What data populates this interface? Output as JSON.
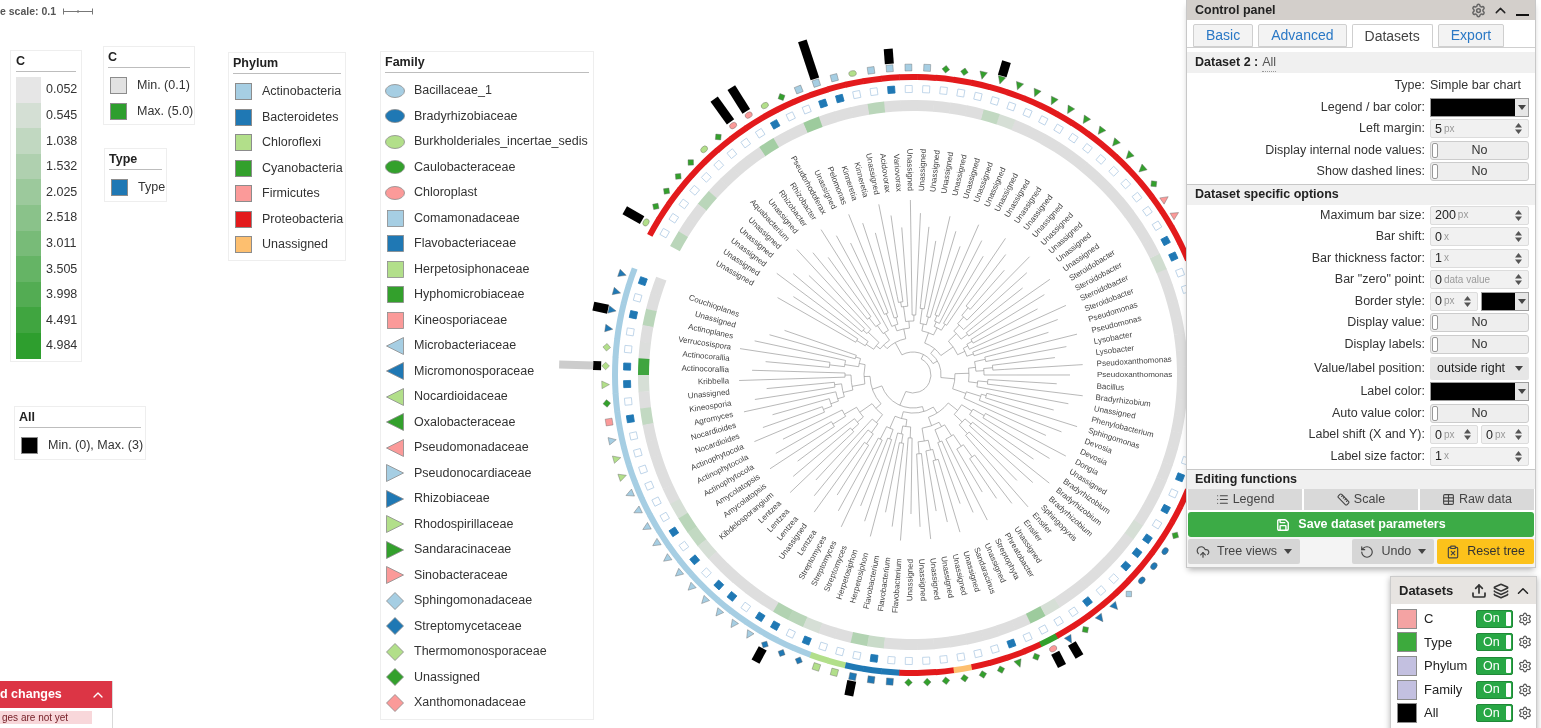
{
  "tree_scale": {
    "label": "e scale: 0.1"
  },
  "legend_c_scale": {
    "title": "C",
    "items": [
      {
        "label": "0.052",
        "color": "#e6e6e6"
      },
      {
        "label": "0.545",
        "color": "#d4dfd4"
      },
      {
        "label": "1.038",
        "color": "#c1d8c1"
      },
      {
        "label": "1.532",
        "color": "#afd0af"
      },
      {
        "label": "2.025",
        "color": "#9cc99c"
      },
      {
        "label": "2.518",
        "color": "#8ac28a"
      },
      {
        "label": "3.011",
        "color": "#78bb78"
      },
      {
        "label": "3.505",
        "color": "#65b465"
      },
      {
        "label": "3.998",
        "color": "#53ac53"
      },
      {
        "label": "4.491",
        "color": "#40a540"
      },
      {
        "label": "4.984",
        "color": "#2e9e2e"
      }
    ]
  },
  "legend_c_range": {
    "title": "C",
    "items": [
      {
        "label": "Min. (0.1)",
        "color": "#e2e2e2"
      },
      {
        "label": "Max. (5.0)",
        "color": "#2e9e2e"
      }
    ]
  },
  "legend_type": {
    "title": "Type",
    "items": [
      {
        "label": "Type",
        "color": "#1f78b4"
      }
    ]
  },
  "legend_phylum": {
    "title": "Phylum",
    "items": [
      {
        "label": "Actinobacteria",
        "color": "#a6cee3"
      },
      {
        "label": "Bacteroidetes",
        "color": "#1f78b4"
      },
      {
        "label": "Chloroflexi",
        "color": "#b2df8a"
      },
      {
        "label": "Cyanobacteria",
        "color": "#33a02c"
      },
      {
        "label": "Firmicutes",
        "color": "#fb9a99"
      },
      {
        "label": "Proteobacteria",
        "color": "#e31a1c"
      },
      {
        "label": "Unassigned",
        "color": "#fdbf6f"
      }
    ]
  },
  "legend_family": {
    "title": "Family",
    "items": [
      {
        "label": "Bacillaceae_1",
        "kind": "circle",
        "color": "#a6cee3"
      },
      {
        "label": "Bradyrhizobiaceae",
        "kind": "circle",
        "color": "#1f78b4"
      },
      {
        "label": "Burkholderiales_incertae_sedis",
        "kind": "circle",
        "color": "#b2df8a"
      },
      {
        "label": "Caulobacteraceae",
        "kind": "circle",
        "color": "#33a02c"
      },
      {
        "label": "Chloroplast",
        "kind": "circle",
        "color": "#fb9a99"
      },
      {
        "label": "Comamonadaceae",
        "kind": "square",
        "color": "#a6cee3"
      },
      {
        "label": "Flavobacteriaceae",
        "kind": "square",
        "color": "#1f78b4"
      },
      {
        "label": "Herpetosiphonaceae",
        "kind": "square",
        "color": "#b2df8a"
      },
      {
        "label": "Hyphomicrobiaceae",
        "kind": "square",
        "color": "#33a02c"
      },
      {
        "label": "Kineosporiaceae",
        "kind": "square",
        "color": "#fb9a99"
      },
      {
        "label": "Microbacteriaceae",
        "kind": "triangle-left",
        "color": "#a6cee3"
      },
      {
        "label": "Micromonosporaceae",
        "kind": "triangle-left",
        "color": "#1f78b4"
      },
      {
        "label": "Nocardioidaceae",
        "kind": "triangle-left",
        "color": "#b2df8a"
      },
      {
        "label": "Oxalobacteraceae",
        "kind": "triangle-left",
        "color": "#33a02c"
      },
      {
        "label": "Pseudomonadaceae",
        "kind": "triangle-left",
        "color": "#fb9a99"
      },
      {
        "label": "Pseudonocardiaceae",
        "kind": "triangle-right",
        "color": "#a6cee3"
      },
      {
        "label": "Rhizobiaceae",
        "kind": "triangle-right",
        "color": "#1f78b4"
      },
      {
        "label": "Rhodospirillaceae",
        "kind": "triangle-right",
        "color": "#b2df8a"
      },
      {
        "label": "Sandaracinaceae",
        "kind": "triangle-right",
        "color": "#33a02c"
      },
      {
        "label": "Sinobacteraceae",
        "kind": "triangle-right",
        "color": "#fb9a99"
      },
      {
        "label": "Sphingomonadaceae",
        "kind": "diamond",
        "color": "#a6cee3"
      },
      {
        "label": "Streptomycetaceae",
        "kind": "diamond",
        "color": "#1f78b4"
      },
      {
        "label": "Thermomonosporaceae",
        "kind": "diamond",
        "color": "#b2df8a"
      },
      {
        "label": "Unassigned",
        "kind": "diamond",
        "color": "#33a02c"
      },
      {
        "label": "Xanthomonadaceae",
        "kind": "diamond",
        "color": "#fb9a99"
      }
    ]
  },
  "legend_all": {
    "title": "All",
    "items": [
      {
        "label": "Min. (0), Max. (3)",
        "color": "#000000"
      }
    ]
  },
  "tree": {
    "leaves": [
      {
        "label": "Couchioplanes",
        "heat": {
          "color": "#dedede"
        },
        "type": {
          "filled": true
        },
        "phylum": {
          "color": "#a6cee3"
        },
        "family": {
          "kind": "triangle-left",
          "color": "#1f78b4"
        }
      },
      {
        "label": "Unassigned",
        "heat": {
          "color": "#dedede"
        },
        "type": {
          "filled": false
        },
        "phylum": {
          "color": "#a6cee3"
        },
        "family": {
          "kind": "triangle-left",
          "color": "#1f78b4"
        }
      },
      {
        "label": "Actinoplanes",
        "heat": {
          "color": "#bad6ba"
        },
        "type": {
          "filled": true
        },
        "phylum": {
          "color": "#a6cee3"
        },
        "family": {
          "kind": "triangle-left",
          "color": "#1f78b4"
        },
        "bar": {
          "kind": "short"
        }
      },
      {
        "label": "Verrucosispora",
        "heat": {
          "color": "#dedede"
        },
        "type": {
          "filled": false
        },
        "phylum": {
          "color": "#a6cee3"
        },
        "family": {
          "kind": "triangle-left",
          "color": "#1f78b4"
        }
      },
      {
        "label": "Actinocorallia",
        "heat": {
          "color": "#dcdedc"
        },
        "type": {
          "filled": false
        },
        "phylum": {
          "color": "#a6cee3"
        },
        "family": {
          "kind": "diamond",
          "color": "#b2df8a"
        }
      },
      {
        "label": "Actinocorallia",
        "heat": {
          "color": "#3fa53f"
        },
        "type": {
          "filled": true
        },
        "phylum": {
          "color": "#a6cee3"
        },
        "family": {
          "kind": "diamond",
          "color": "#b2df8a"
        },
        "bar": {
          "kind": "tiny",
          "overflow": true
        }
      },
      {
        "label": "Kribbella",
        "heat": {
          "color": "#d6dfd6"
        },
        "type": {
          "filled": true
        },
        "phylum": {
          "color": "#a6cee3"
        },
        "family": {
          "kind": "triangle-left",
          "color": "#b2df8a"
        }
      },
      {
        "label": "Unassigned",
        "heat": {
          "color": "#dedede"
        },
        "type": {
          "filled": false
        },
        "phylum": {
          "color": "#a6cee3"
        },
        "family": {
          "kind": "diamond",
          "color": "#33a02c"
        }
      },
      {
        "label": "Kineosporia",
        "heat": {
          "color": "#c2d9c2"
        },
        "type": {
          "filled": true
        },
        "phylum": {
          "color": "#a6cee3"
        },
        "family": {
          "kind": "square",
          "color": "#fb9a99"
        }
      },
      {
        "label": "Agromyces",
        "heat": {
          "color": "#dedede"
        },
        "type": {
          "filled": false
        },
        "phylum": {
          "color": "#a6cee3"
        },
        "family": {
          "kind": "triangle-left",
          "color": "#a6cee3"
        }
      },
      {
        "label": "Nocardioides",
        "heat": {
          "color": "#dedede"
        },
        "type": {
          "filled": false
        },
        "phylum": {
          "color": "#a6cee3"
        },
        "family": {
          "kind": "triangle-left",
          "color": "#b2df8a"
        }
      },
      {
        "label": "Nocardioides",
        "heat": {
          "color": "#dedede"
        },
        "type": {
          "filled": false
        },
        "phylum": {
          "color": "#a6cee3"
        },
        "family": {
          "kind": "triangle-left",
          "color": "#b2df8a"
        }
      },
      {
        "label": "Actinophytocola",
        "heat": {
          "color": "#dedede"
        },
        "type": {
          "filled": false
        },
        "phylum": {
          "color": "#a6cee3"
        },
        "family": {
          "kind": "triangle-right",
          "color": "#a6cee3"
        }
      },
      {
        "label": "Actinophytocola",
        "heat": {
          "color": "#dedede"
        },
        "type": {
          "filled": false
        },
        "phylum": {
          "color": "#a6cee3"
        },
        "family": {
          "kind": "triangle-right",
          "color": "#a6cee3"
        }
      },
      {
        "label": "Actinophytocola",
        "heat": {
          "color": "#d6dfd6"
        },
        "type": {
          "filled": false
        },
        "phylum": {
          "color": "#a6cee3"
        },
        "family": {
          "kind": "triangle-right",
          "color": "#a6cee3"
        }
      },
      {
        "label": "Amycolatopsis",
        "heat": {
          "color": "#bad6ba"
        },
        "type": {
          "filled": true
        },
        "phylum": {
          "color": "#a6cee3"
        },
        "family": {
          "kind": "triangle-right",
          "color": "#a6cee3"
        }
      },
      {
        "label": "Amycolatopsis",
        "heat": {
          "color": "#c2d9c2"
        },
        "type": {
          "filled": false
        },
        "phylum": {
          "color": "#a6cee3"
        },
        "family": {
          "kind": "triangle-right",
          "color": "#a6cee3"
        }
      },
      {
        "label": "Kibdelosporangium",
        "heat": {
          "color": "#d6dfd6"
        },
        "type": {
          "filled": true
        },
        "phylum": {
          "color": "#a6cee3"
        },
        "family": {
          "kind": "triangle-right",
          "color": "#a6cee3"
        }
      },
      {
        "label": "Lentzea",
        "heat": {
          "color": "#dedede"
        },
        "type": {
          "filled": false
        },
        "phylum": {
          "color": "#a6cee3"
        },
        "family": {
          "kind": "triangle-right",
          "color": "#a6cee3"
        }
      },
      {
        "label": "Lentzea",
        "heat": {
          "color": "#dedede"
        },
        "type": {
          "filled": true
        },
        "phylum": {
          "color": "#a6cee3"
        },
        "family": {
          "kind": "triangle-right",
          "color": "#a6cee3"
        }
      },
      {
        "label": "Lentzea",
        "heat": {
          "color": "#dedede"
        },
        "type": {
          "filled": true
        },
        "phylum": {
          "color": "#a6cee3"
        },
        "family": {
          "kind": "triangle-right",
          "color": "#a6cee3"
        }
      },
      {
        "label": "Unassigned",
        "heat": {
          "color": "#dedede"
        },
        "type": {
          "filled": false
        },
        "phylum": {
          "color": "#a6cee3"
        },
        "family": {
          "kind": "triangle-right",
          "color": "#a6cee3"
        }
      },
      {
        "label": "Lentzea",
        "heat": {
          "color": "#dedede"
        },
        "type": {
          "filled": true
        },
        "phylum": {
          "color": "#a6cee3"
        },
        "family": {
          "kind": "triangle-right",
          "color": "#a6cee3"
        }
      },
      {
        "label": "Streptomyces",
        "heat": {
          "color": "#b2d3b2"
        },
        "type": {
          "filled": true
        },
        "phylum": {
          "color": "#a6cee3"
        },
        "family": {
          "kind": "diamond",
          "color": "#1f78b4"
        },
        "bar": {
          "kind": "short"
        }
      },
      {
        "label": "Streptomyces",
        "heat": {
          "color": "#bad6ba"
        },
        "type": {
          "filled": false
        },
        "phylum": {
          "color": "#a6cee3"
        },
        "family": {
          "kind": "diamond",
          "color": "#1f78b4"
        }
      },
      {
        "label": "Streptomyces",
        "heat": {
          "color": "#d6dfd6"
        },
        "type": {
          "filled": true
        },
        "phylum": {
          "color": "#a6cee3"
        },
        "family": {
          "kind": "diamond",
          "color": "#1f78b4"
        }
      },
      {
        "label": "Herpetosiphon",
        "heat": {
          "color": "#dedede"
        },
        "type": {
          "filled": false
        },
        "phylum": {
          "color": "#b2df8a"
        },
        "family": {
          "kind": "square",
          "color": "#b2df8a"
        }
      },
      {
        "label": "Herpetosiphon",
        "heat": {
          "color": "#dedede"
        },
        "type": {
          "filled": false
        },
        "phylum": {
          "color": "#b2df8a"
        },
        "family": {
          "kind": "square",
          "color": "#b2df8a"
        }
      },
      {
        "label": "Flavobacterium",
        "heat": {
          "color": "#b2d3b2"
        },
        "type": {
          "filled": false
        },
        "phylum": {
          "color": "#1f78b4"
        },
        "family": {
          "kind": "square",
          "color": "#1f78b4"
        },
        "bar": {
          "kind": "short"
        }
      },
      {
        "label": "Flavobacterium",
        "heat": {
          "color": "#c9dbc9"
        },
        "type": {
          "filled": true
        },
        "phylum": {
          "color": "#1f78b4"
        },
        "family": {
          "kind": "square",
          "color": "#1f78b4"
        }
      },
      {
        "label": "Flavobacterium",
        "heat": {
          "color": "#dedede"
        },
        "type": {
          "filled": false
        },
        "phylum": {
          "color": "#1f78b4"
        },
        "family": {
          "kind": "square",
          "color": "#1f78b4"
        }
      },
      {
        "label": "Unassigned",
        "heat": {
          "color": "#dedede"
        },
        "type": {
          "filled": false
        },
        "phylum": {
          "color": "#e31a1c"
        },
        "family": {
          "kind": "diamond",
          "color": "#33a02c"
        }
      },
      {
        "label": "Unassigned",
        "heat": {
          "color": "#dedede"
        },
        "type": {
          "filled": false
        },
        "phylum": {
          "color": "#e31a1c"
        },
        "family": {
          "kind": "diamond",
          "color": "#33a02c"
        }
      },
      {
        "label": "Unassigned",
        "heat": {
          "color": "#dedede"
        },
        "type": {
          "filled": false
        },
        "phylum": {
          "color": "#e31a1c"
        },
        "family": {
          "kind": "diamond",
          "color": "#33a02c"
        }
      },
      {
        "label": "Unassigned",
        "heat": {
          "color": "#dedede"
        },
        "type": {
          "filled": false
        },
        "phylum": {
          "color": "#fdbf6f"
        },
        "family": {
          "kind": "diamond",
          "color": "#33a02c"
        }
      },
      {
        "label": "Unassigned",
        "heat": {
          "color": "#dedede"
        },
        "type": {
          "filled": false
        },
        "phylum": {
          "color": "#e31a1c"
        },
        "family": {
          "kind": "diamond",
          "color": "#33a02c"
        }
      },
      {
        "label": "Unassigned",
        "heat": {
          "color": "#dedede"
        },
        "type": {
          "filled": false
        },
        "phylum": {
          "color": "#e31a1c"
        },
        "family": {
          "kind": "diamond",
          "color": "#33a02c"
        }
      },
      {
        "label": "Sandaracinus",
        "heat": {
          "color": "#dedede"
        },
        "type": {
          "filled": true
        },
        "phylum": {
          "color": "#e31a1c"
        },
        "family": {
          "kind": "triangle-right",
          "color": "#33a02c"
        }
      },
      {
        "label": "Unassigned",
        "heat": {
          "color": "#dedede"
        },
        "type": {
          "filled": false
        },
        "phylum": {
          "color": "#e31a1c"
        },
        "family": {
          "kind": "diamond",
          "color": "#33a02c"
        }
      },
      {
        "label": "Streptophyta",
        "heat": {
          "color": "#9dcb9d"
        },
        "type": {
          "filled": false
        },
        "phylum": {
          "color": "#33a02c"
        },
        "family": {
          "kind": "circle",
          "color": "#fb9a99"
        },
        "bar": {
          "kind": "short"
        }
      },
      {
        "label": "Phreatobacter",
        "heat": {
          "color": "#d6dfd6"
        },
        "type": {
          "filled": false
        },
        "phylum": {
          "color": "#e31a1c"
        },
        "family": {
          "kind": "triangle-right",
          "color": "#1f78b4"
        },
        "bar": {
          "kind": "short"
        }
      },
      {
        "label": "Unassigned",
        "heat": {
          "color": "#dedede"
        },
        "type": {
          "filled": false
        },
        "phylum": {
          "color": "#e31a1c"
        },
        "family": {
          "kind": "diamond",
          "color": "#33a02c"
        }
      },
      {
        "label": "Ensifer",
        "heat": {
          "color": "#dedede"
        },
        "type": {
          "filled": true
        },
        "phylum": {
          "color": "#e31a1c"
        },
        "family": {
          "kind": "triangle-right",
          "color": "#1f78b4"
        }
      },
      {
        "label": "Ensifer",
        "heat": {
          "color": "#dedede"
        },
        "type": {
          "filled": false
        },
        "phylum": {
          "color": "#e31a1c"
        },
        "family": {
          "kind": "triangle-right",
          "color": "#1f78b4"
        }
      },
      {
        "label": "Sphingopyxis",
        "heat": {
          "color": "#dedede"
        },
        "type": {
          "filled": false
        },
        "phylum": {
          "color": "#e31a1c"
        },
        "family": {
          "kind": "diamond",
          "color": "#a6cee3"
        }
      },
      {
        "label": "Bradyrhizobium",
        "heat": {
          "color": "#dedede"
        },
        "type": {
          "filled": true
        },
        "phylum": {
          "color": "#e31a1c"
        },
        "family": {
          "kind": "circle",
          "color": "#1f78b4"
        }
      },
      {
        "label": "Bradyrhizobium",
        "heat": {
          "color": "#dedede"
        },
        "type": {
          "filled": true
        },
        "phylum": {
          "color": "#e31a1c"
        },
        "family": {
          "kind": "circle",
          "color": "#1f78b4"
        }
      },
      {
        "label": "Bradyrhizobium",
        "heat": {
          "color": "#d6dfd6"
        },
        "type": {
          "filled": true
        },
        "phylum": {
          "color": "#e31a1c"
        },
        "family": {
          "kind": "circle",
          "color": "#1f78b4"
        }
      },
      {
        "label": "Unassigned",
        "heat": {
          "color": "#dedede"
        },
        "type": {
          "filled": false
        },
        "phylum": {
          "color": "#e31a1c"
        },
        "family": {
          "kind": "diamond",
          "color": "#33a02c"
        }
      },
      {
        "label": "Dongia",
        "heat": {
          "color": "#dedede"
        },
        "type": {
          "filled": true
        },
        "phylum": {
          "color": "#e31a1c"
        }
      },
      {
        "label": "Devosia",
        "heat": {
          "color": "#dedede"
        },
        "type": {
          "filled": false
        },
        "phylum": {
          "color": "#e31a1c"
        }
      },
      {
        "label": "Devosia",
        "heat": {
          "color": "#dedede"
        },
        "type": {
          "filled": true
        }
      },
      {
        "label": "Sphingomonas",
        "heat": {
          "color": "#dedede"
        },
        "type": {
          "filled": false
        }
      },
      {
        "label": "Phenylobacterium",
        "heat": {
          "color": "#dedede"
        }
      },
      {
        "label": "Unassigned",
        "heat": {
          "color": "#dedede"
        }
      },
      {
        "label": "Bradyrhizobium",
        "heat": {
          "color": "#dedede"
        }
      },
      {
        "label": "Bacillus",
        "heat": {
          "color": "#dedede"
        }
      },
      {
        "label": "Pseudoxanthomonas",
        "heat": {
          "color": "#dedede"
        }
      },
      {
        "label": "Pseudoxanthomonas",
        "heat": {
          "color": "#dedede"
        }
      },
      {
        "label": "Lysobacter",
        "heat": {
          "color": "#dedede"
        }
      },
      {
        "label": "Lysobacter",
        "heat": {
          "color": "#dedede"
        }
      },
      {
        "label": "Pseudomonas",
        "heat": {
          "color": "#dedede"
        }
      },
      {
        "label": "Pseudomonas",
        "heat": {
          "color": "#dedede"
        },
        "type": {
          "filled": false
        }
      },
      {
        "label": "Steroidobacter",
        "heat": {
          "color": "#dedede"
        },
        "type": {
          "filled": false
        }
      },
      {
        "label": "Steroidobacter",
        "heat": {
          "color": "#d0ddd0"
        },
        "type": {
          "filled": true
        },
        "phylum": {
          "color": "#e31a1c"
        }
      },
      {
        "label": "Steroidobacter",
        "heat": {
          "color": "#dedede"
        },
        "type": {
          "filled": true
        },
        "phylum": {
          "color": "#e31a1c"
        }
      },
      {
        "label": "Steroidobacter",
        "heat": {
          "color": "#dedede"
        },
        "type": {
          "filled": false
        },
        "phylum": {
          "color": "#e31a1c"
        },
        "family": {
          "kind": "triangle-right",
          "color": "#fb9a99"
        }
      },
      {
        "label": "Unassigned",
        "heat": {
          "color": "#dedede"
        },
        "type": {
          "filled": false
        },
        "phylum": {
          "color": "#e31a1c"
        },
        "family": {
          "kind": "triangle-right",
          "color": "#fb9a99"
        }
      },
      {
        "label": "Unassigned",
        "heat": {
          "color": "#dedede"
        },
        "type": {
          "filled": false
        },
        "phylum": {
          "color": "#e31a1c"
        },
        "family": {
          "kind": "diamond",
          "color": "#33a02c"
        }
      },
      {
        "label": "Unassigned",
        "heat": {
          "color": "#dedede"
        },
        "type": {
          "filled": false
        },
        "phylum": {
          "color": "#e31a1c"
        },
        "family": {
          "kind": "triangle-left",
          "color": "#33a02c"
        }
      },
      {
        "label": "Unassigned",
        "heat": {
          "color": "#dedede"
        },
        "type": {
          "filled": false
        },
        "phylum": {
          "color": "#e31a1c"
        },
        "family": {
          "kind": "triangle-left",
          "color": "#33a02c"
        }
      },
      {
        "label": "Unassigned",
        "heat": {
          "color": "#dedede"
        },
        "type": {
          "filled": false
        },
        "phylum": {
          "color": "#e31a1c"
        },
        "family": {
          "kind": "triangle-left",
          "color": "#33a02c"
        }
      },
      {
        "label": "Unassigned",
        "heat": {
          "color": "#dedede"
        },
        "type": {
          "filled": false
        },
        "phylum": {
          "color": "#e31a1c"
        },
        "family": {
          "kind": "triangle-left",
          "color": "#33a02c"
        }
      },
      {
        "label": "Unassigned",
        "heat": {
          "color": "#dedede"
        },
        "type": {
          "filled": false
        },
        "phylum": {
          "color": "#e31a1c"
        },
        "family": {
          "kind": "triangle-left",
          "color": "#33a02c"
        }
      },
      {
        "label": "Unassigned",
        "heat": {
          "color": "#dedede"
        },
        "type": {
          "filled": false
        },
        "phylum": {
          "color": "#e31a1c"
        },
        "family": {
          "kind": "triangle-left",
          "color": "#33a02c"
        }
      },
      {
        "label": "Unassigned",
        "heat": {
          "color": "#dedede"
        },
        "type": {
          "filled": false
        },
        "phylum": {
          "color": "#e31a1c"
        },
        "family": {
          "kind": "triangle-left",
          "color": "#33a02c"
        }
      },
      {
        "label": "Unassigned",
        "heat": {
          "color": "#dedede"
        },
        "type": {
          "filled": false
        },
        "phylum": {
          "color": "#e31a1c"
        },
        "family": {
          "kind": "triangle-left",
          "color": "#33a02c"
        }
      },
      {
        "label": "Unassigned",
        "heat": {
          "color": "#d6dfd6"
        },
        "type": {
          "filled": false
        },
        "phylum": {
          "color": "#e31a1c"
        },
        "family": {
          "kind": "triangle-left",
          "color": "#33a02c"
        }
      },
      {
        "label": "Unassigned",
        "heat": {
          "color": "#c2d9c2"
        },
        "type": {
          "filled": false
        },
        "phylum": {
          "color": "#e31a1c"
        },
        "family": {
          "kind": "triangle-left",
          "color": "#33a02c"
        },
        "bar": {
          "kind": "short"
        }
      },
      {
        "label": "Unassigned",
        "heat": {
          "color": "#dedede"
        },
        "type": {
          "filled": false
        },
        "phylum": {
          "color": "#e31a1c"
        },
        "family": {
          "kind": "triangle-left",
          "color": "#33a02c"
        }
      },
      {
        "label": "Unassigned",
        "heat": {
          "color": "#dedede"
        },
        "type": {
          "filled": false
        },
        "phylum": {
          "color": "#e31a1c"
        },
        "family": {
          "kind": "diamond",
          "color": "#33a02c"
        }
      },
      {
        "label": "Unassigned",
        "heat": {
          "color": "#dedede"
        },
        "type": {
          "filled": false
        },
        "phylum": {
          "color": "#e31a1c"
        },
        "family": {
          "kind": "diamond",
          "color": "#33a02c"
        }
      },
      {
        "label": "Unassigned",
        "heat": {
          "color": "#dedede"
        },
        "type": {
          "filled": false
        },
        "phylum": {
          "color": "#e31a1c"
        },
        "family": {
          "kind": "square",
          "color": "#a6cee3"
        }
      },
      {
        "label": "Unassigned",
        "heat": {
          "color": "#dedede"
        },
        "type": {
          "filled": false
        },
        "phylum": {
          "color": "#e31a1c"
        },
        "family": {
          "kind": "square",
          "color": "#a6cee3"
        }
      },
      {
        "label": "Variovorax",
        "heat": {
          "color": "#dedede"
        },
        "type": {
          "filled": true
        },
        "phylum": {
          "color": "#e31a1c"
        },
        "family": {
          "kind": "square",
          "color": "#a6cee3"
        },
        "bar": {
          "kind": "short"
        }
      },
      {
        "label": "Acidovorax",
        "heat": {
          "color": "#bad6ba"
        },
        "type": {
          "filled": false
        },
        "phylum": {
          "color": "#e31a1c"
        },
        "family": {
          "kind": "square",
          "color": "#a6cee3"
        }
      },
      {
        "label": "Unassigned",
        "heat": {
          "color": "#dedede"
        },
        "type": {
          "filled": false
        },
        "phylum": {
          "color": "#e31a1c"
        },
        "family": {
          "kind": "circle",
          "color": "#b2df8a"
        }
      },
      {
        "label": "Kinneretia",
        "heat": {
          "color": "#dedede"
        },
        "type": {
          "filled": true
        },
        "phylum": {
          "color": "#e31a1c"
        },
        "family": {
          "kind": "square",
          "color": "#a6cee3"
        }
      },
      {
        "label": "Kinneretia",
        "heat": {
          "color": "#dedede"
        },
        "type": {
          "filled": true
        },
        "phylum": {
          "color": "#e31a1c"
        },
        "family": {
          "kind": "square",
          "color": "#a6cee3"
        },
        "bar": {
          "kind": "longest"
        }
      },
      {
        "label": "Pelomonas",
        "heat": {
          "color": "#9dcb9d"
        },
        "type": {
          "filled": false
        },
        "phylum": {
          "color": "#e31a1c"
        },
        "family": {
          "kind": "square",
          "color": "#a6cee3"
        }
      },
      {
        "label": "Unassigned",
        "heat": {
          "color": "#dedede"
        },
        "type": {
          "filled": false
        },
        "phylum": {
          "color": "#e31a1c"
        },
        "family": {
          "kind": "diamond",
          "color": "#33a02c"
        }
      },
      {
        "label": "Pseudorhodoferax",
        "heat": {
          "color": "#dedede"
        },
        "type": {
          "filled": true
        },
        "phylum": {
          "color": "#e31a1c"
        },
        "family": {
          "kind": "circle",
          "color": "#b2df8a"
        }
      },
      {
        "label": "Rhizobacter",
        "heat": {
          "color": "#a4cea4"
        },
        "type": {
          "filled": false
        },
        "phylum": {
          "color": "#e31a1c"
        },
        "family": {
          "kind": "circle",
          "color": "#fb9a99"
        },
        "bar": {
          "kind": "long"
        }
      },
      {
        "label": "Rhizobacter",
        "heat": {
          "color": "#dedede"
        },
        "type": {
          "filled": false
        },
        "phylum": {
          "color": "#e31a1c"
        },
        "family": {
          "kind": "circle",
          "color": "#fb9a99"
        },
        "bar": {
          "kind": "long"
        }
      },
      {
        "label": "Unassigned",
        "heat": {
          "color": "#dedede"
        },
        "type": {
          "filled": false
        },
        "phylum": {
          "color": "#e31a1c"
        },
        "family": {
          "kind": "diamond",
          "color": "#33a02c"
        }
      },
      {
        "label": "Aquabacterium",
        "heat": {
          "color": "#dedede"
        },
        "type": {
          "filled": false
        },
        "phylum": {
          "color": "#e31a1c"
        },
        "family": {
          "kind": "circle",
          "color": "#b2df8a"
        }
      },
      {
        "label": "Unassigned",
        "heat": {
          "color": "#dedede"
        },
        "type": {
          "filled": false
        },
        "phylum": {
          "color": "#e31a1c"
        },
        "family": {
          "kind": "diamond",
          "color": "#33a02c"
        }
      },
      {
        "label": "Unassigned",
        "heat": {
          "color": "#bad6ba"
        },
        "type": {
          "filled": false
        },
        "phylum": {
          "color": "#e31a1c"
        },
        "family": {
          "kind": "diamond",
          "color": "#33a02c"
        }
      },
      {
        "label": "Unassigned",
        "heat": {
          "color": "#dedede"
        },
        "type": {
          "filled": false
        },
        "phylum": {
          "color": "#e31a1c"
        },
        "family": {
          "kind": "diamond",
          "color": "#33a02c"
        }
      },
      {
        "label": "Unassigned",
        "heat": {
          "color": "#dedede"
        },
        "type": {
          "filled": false
        },
        "phylum": {
          "color": "#e31a1c"
        },
        "family": {
          "kind": "diamond",
          "color": "#33a02c"
        }
      },
      {
        "label": "Unassigned",
        "heat": {
          "color": "#bad6ba"
        },
        "type": {
          "filled": false
        },
        "phylum": {
          "color": "#e31a1c"
        },
        "family": {
          "kind": "circle",
          "color": "#b2df8a"
        },
        "bar": {
          "kind": "medium"
        }
      }
    ]
  },
  "control_panel": {
    "title": "Control panel",
    "tabs": [
      {
        "label": "Basic",
        "selected": false
      },
      {
        "label": "Advanced",
        "selected": false
      },
      {
        "label": "Datasets",
        "selected": true
      },
      {
        "label": "Export",
        "selected": false
      }
    ],
    "dataset_header": {
      "title": "Dataset 2 :",
      "value": "All"
    },
    "general_rows": [
      {
        "kind": "text",
        "label": "Type:",
        "value": "Simple bar chart"
      },
      {
        "kind": "color",
        "label": "Legend / bar color:",
        "color": "#000000"
      },
      {
        "kind": "number",
        "label": "Left margin:",
        "value": "5",
        "unit": "px"
      },
      {
        "kind": "toggle",
        "label": "Display internal node values:",
        "on": false,
        "value": "No"
      },
      {
        "kind": "toggle",
        "label": "Show dashed lines:",
        "on": false,
        "value": "No"
      }
    ],
    "options_title": "Dataset specific options",
    "option_rows": [
      {
        "kind": "number",
        "label": "Maximum bar size:",
        "value": "200",
        "unit": "px"
      },
      {
        "kind": "number",
        "label": "Bar shift:",
        "value": "0",
        "unit": "x"
      },
      {
        "kind": "number",
        "label": "Bar thickness factor:",
        "value": "1",
        "unit": "x"
      },
      {
        "kind": "number",
        "label": "Bar \"zero\" point:",
        "value": "0",
        "unit": "data value"
      },
      {
        "kind": "number_color",
        "label": "Border style:",
        "value": "0",
        "unit": "px",
        "color": "#000000"
      },
      {
        "kind": "toggle",
        "label": "Display value:",
        "on": false,
        "value": "No"
      },
      {
        "kind": "toggle",
        "label": "Display labels:",
        "on": false,
        "value": "No"
      },
      {
        "kind": "select",
        "label": "Value/label position:",
        "value": "outside right"
      },
      {
        "kind": "color",
        "label": "Label color:",
        "color": "#000000"
      },
      {
        "kind": "toggle",
        "label": "Auto value color:",
        "on": false,
        "value": "No"
      },
      {
        "kind": "number_pair",
        "label": "Label shift (X and Y):",
        "fields": [
          {
            "value": "0",
            "unit": "px"
          },
          {
            "value": "0",
            "unit": "px"
          }
        ]
      },
      {
        "kind": "number",
        "label": "Label size factor:",
        "value": "1",
        "unit": "x"
      }
    ],
    "editing_title": "Editing functions",
    "editing_buttons": [
      {
        "label": "Legend"
      },
      {
        "label": "Scale"
      },
      {
        "label": "Raw data"
      }
    ],
    "save_button": {
      "label": "Save dataset parameters"
    },
    "footer_buttons": [
      {
        "label": "Tree views",
        "kind": "dropdown"
      },
      {
        "label": "Undo",
        "kind": "dropdown"
      },
      {
        "label": "Reset tree",
        "kind": "warning"
      }
    ]
  },
  "datasets_panel": {
    "title": "Datasets",
    "items": [
      {
        "label": "C",
        "color": "#f4a3a3",
        "on": true,
        "value": "On"
      },
      {
        "label": "Type",
        "color": "#3daa3d",
        "on": true,
        "value": "On"
      },
      {
        "label": "Phylum",
        "color": "#c3c0e0",
        "on": true,
        "value": "On"
      },
      {
        "label": "Family",
        "color": "#c3c0e0",
        "on": true,
        "value": "On"
      },
      {
        "label": "All",
        "color": "#000000",
        "on": true,
        "value": "On"
      }
    ]
  },
  "notice": {
    "title": "d changes",
    "message": "ges are not yet"
  }
}
